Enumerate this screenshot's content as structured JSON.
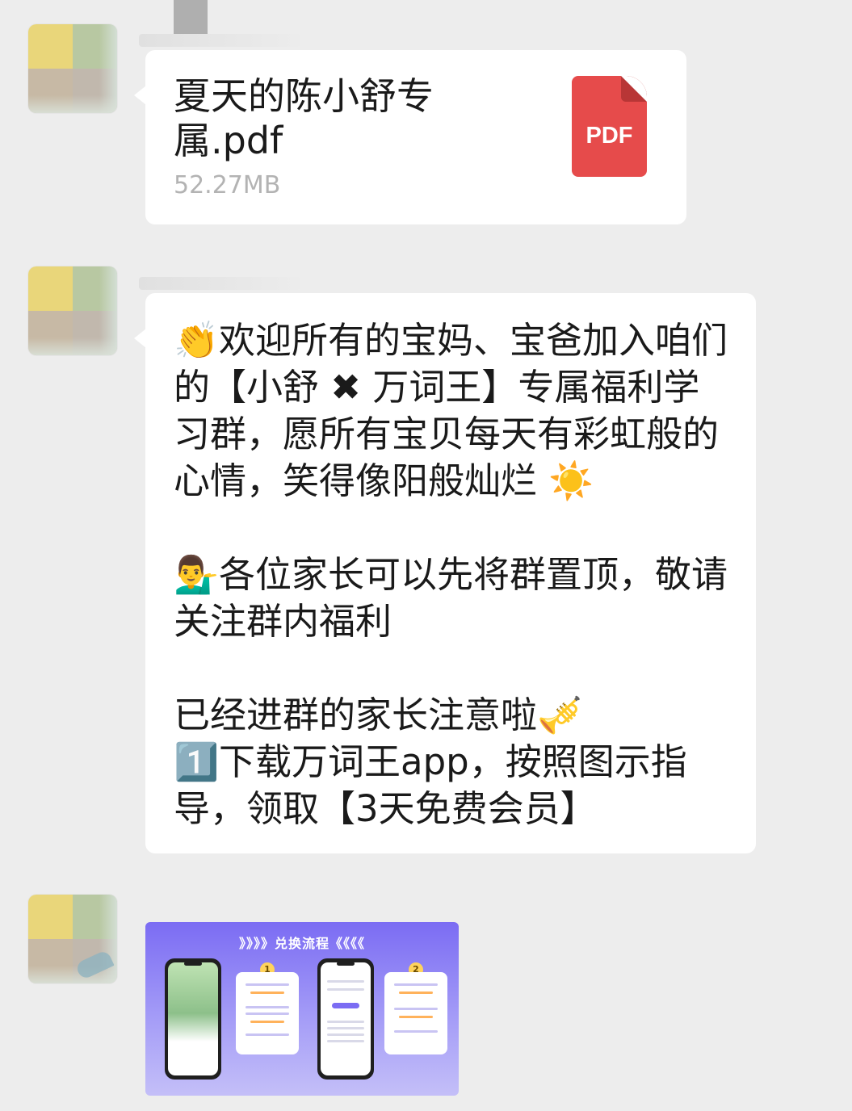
{
  "messages": [
    {
      "type": "file",
      "file_name": "夏天的陈小舒专属.pdf",
      "file_size": "52.27MB",
      "icon_label": "PDF",
      "icon_name": "pdf-icon"
    },
    {
      "type": "text",
      "text": "👏欢迎所有的宝妈、宝爸加入咱们的【小舒 ✖ 万词王】专属福利学习群，愿所有宝贝每天有彩虹般的心情，笑得像阳般灿烂 ☀️\n\n💁‍♂️各位家长可以先将群置顶，敬请关注群内福利\n\n已经进群的家长注意啦🎺\n1️⃣下载万词王app，按照图示指导，领取【3天免费会员】"
    },
    {
      "type": "image",
      "title": "》》》》兑换流程《《《《",
      "steps": [
        "1",
        "2"
      ]
    }
  ],
  "colors": {
    "background": "#ededed",
    "bubble": "#ffffff",
    "pdf_red": "#e64b4b",
    "file_size_gray": "#b3b3b3",
    "image_purple": "#7b6cf3"
  }
}
